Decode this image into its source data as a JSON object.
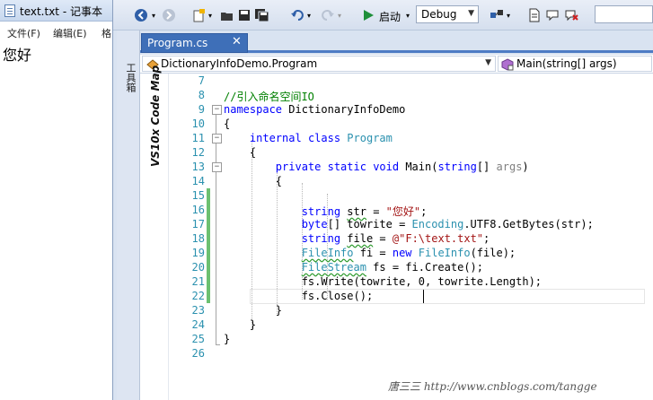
{
  "notepad": {
    "title": "text.txt - 记事本",
    "menu": [
      "文件(F)",
      "编辑(E)",
      "格"
    ],
    "content": "您好"
  },
  "toolbar": {
    "start_label": "启动",
    "config": "Debug"
  },
  "toolbox": {
    "label": "工具箱"
  },
  "tab": {
    "label": "Program.cs",
    "close": "✕"
  },
  "nav": {
    "type_selector": "DictionaryInfoDemo.Program",
    "member_selector": "Main(string[] args)"
  },
  "codemap": {
    "label": "VS10x Code Map"
  },
  "editor": {
    "line_numbers": [
      "7",
      "8",
      "9",
      "10",
      "11",
      "12",
      "13",
      "14",
      "15",
      "16",
      "17",
      "18",
      "19",
      "20",
      "21",
      "22",
      "23",
      "24",
      "25",
      "26"
    ],
    "lines": {
      "l8": "//引入命名空间IO",
      "l9a": "namespace",
      "l9b": " DictionaryInfoDemo",
      "l10": "{",
      "l11a": "internal",
      "l11b": "class",
      "l11c": "Program",
      "l12": "{",
      "l13a": "private",
      "l13b": "static",
      "l13c": "void",
      "l13d": " Main(",
      "l13e": "string",
      "l13f": "[] ",
      "l13g": "args",
      "l13h": ")",
      "l14": "{",
      "l16a": "string",
      "l16b": "str",
      "l16c": " = ",
      "l16d": "\"您好\"",
      "l16e": ";",
      "l17a": "byte",
      "l17b": "[] towrite = ",
      "l17c": "Encoding",
      "l17d": ".UTF8.GetBytes(str);",
      "l18a": "string",
      "l18b": "file",
      "l18c": " = ",
      "l18d": "@\"F:\\text.txt\"",
      "l18e": ";",
      "l19a": "FileInfo",
      "l19b": " fi = ",
      "l19c": "new",
      "l19d": "FileInfo",
      "l19e": "(file);",
      "l20a": "FileStream",
      "l20b": " fs = fi.Create();",
      "l21": "fs.Write(towrite, 0, towrite.Length);",
      "l22": "fs.Close();",
      "l23": "}",
      "l24": "}",
      "l25": "}"
    }
  },
  "watermark": "唐三三 http://www.cnblogs.com/tangge",
  "colors": {
    "keyword": "#0000ff",
    "type": "#2b91af",
    "comment": "#008000",
    "string": "#a31515",
    "tab_active": "#3e6fb8"
  }
}
